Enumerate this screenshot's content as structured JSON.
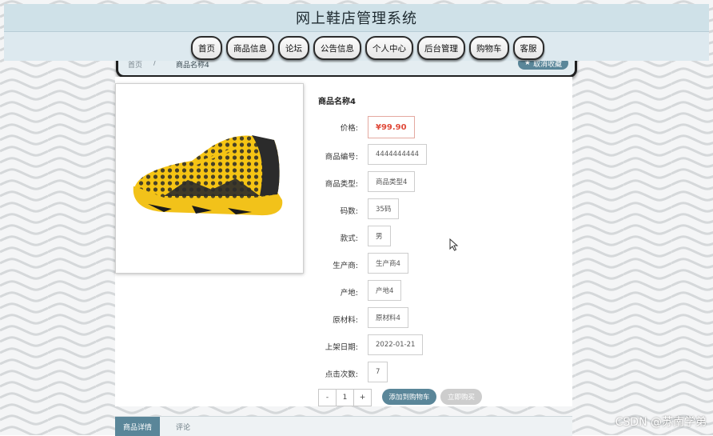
{
  "header": {
    "title": "网上鞋店管理系统"
  },
  "nav": {
    "items": [
      "首页",
      "商品信息",
      "论坛",
      "公告信息",
      "个人中心",
      "后台管理",
      "购物车",
      "客服"
    ]
  },
  "breadcrumb": {
    "home": "首页",
    "separator": "/",
    "current": "商品名称4",
    "favorite_label": "取消收藏"
  },
  "product": {
    "name": "商品名称4",
    "price_label": "价格:",
    "price": "¥99.90",
    "code_label": "商品编号:",
    "code": "4444444444",
    "type_label": "商品类型:",
    "type": "商品类型4",
    "size_label": "码数:",
    "size": "35码",
    "style_label": "款式:",
    "style": "男",
    "maker_label": "生产商:",
    "maker": "生产商4",
    "origin_label": "产地:",
    "origin": "产地4",
    "material_label": "原材料:",
    "material": "原材料4",
    "date_label": "上架日期:",
    "date": "2022-01-21",
    "clicks_label": "点击次数:",
    "clicks": "7"
  },
  "actions": {
    "minus": "-",
    "quantity": "1",
    "plus": "+",
    "add_to_cart": "添加到购物车",
    "buy_now": "立即购买"
  },
  "tabs": {
    "details": "商品详情",
    "comments": "评论"
  },
  "watermark": "CSDN @苏南学弟",
  "colors": {
    "accent": "#5a8699",
    "price": "#e04a3a",
    "header_bg": "#cfe1e8"
  }
}
